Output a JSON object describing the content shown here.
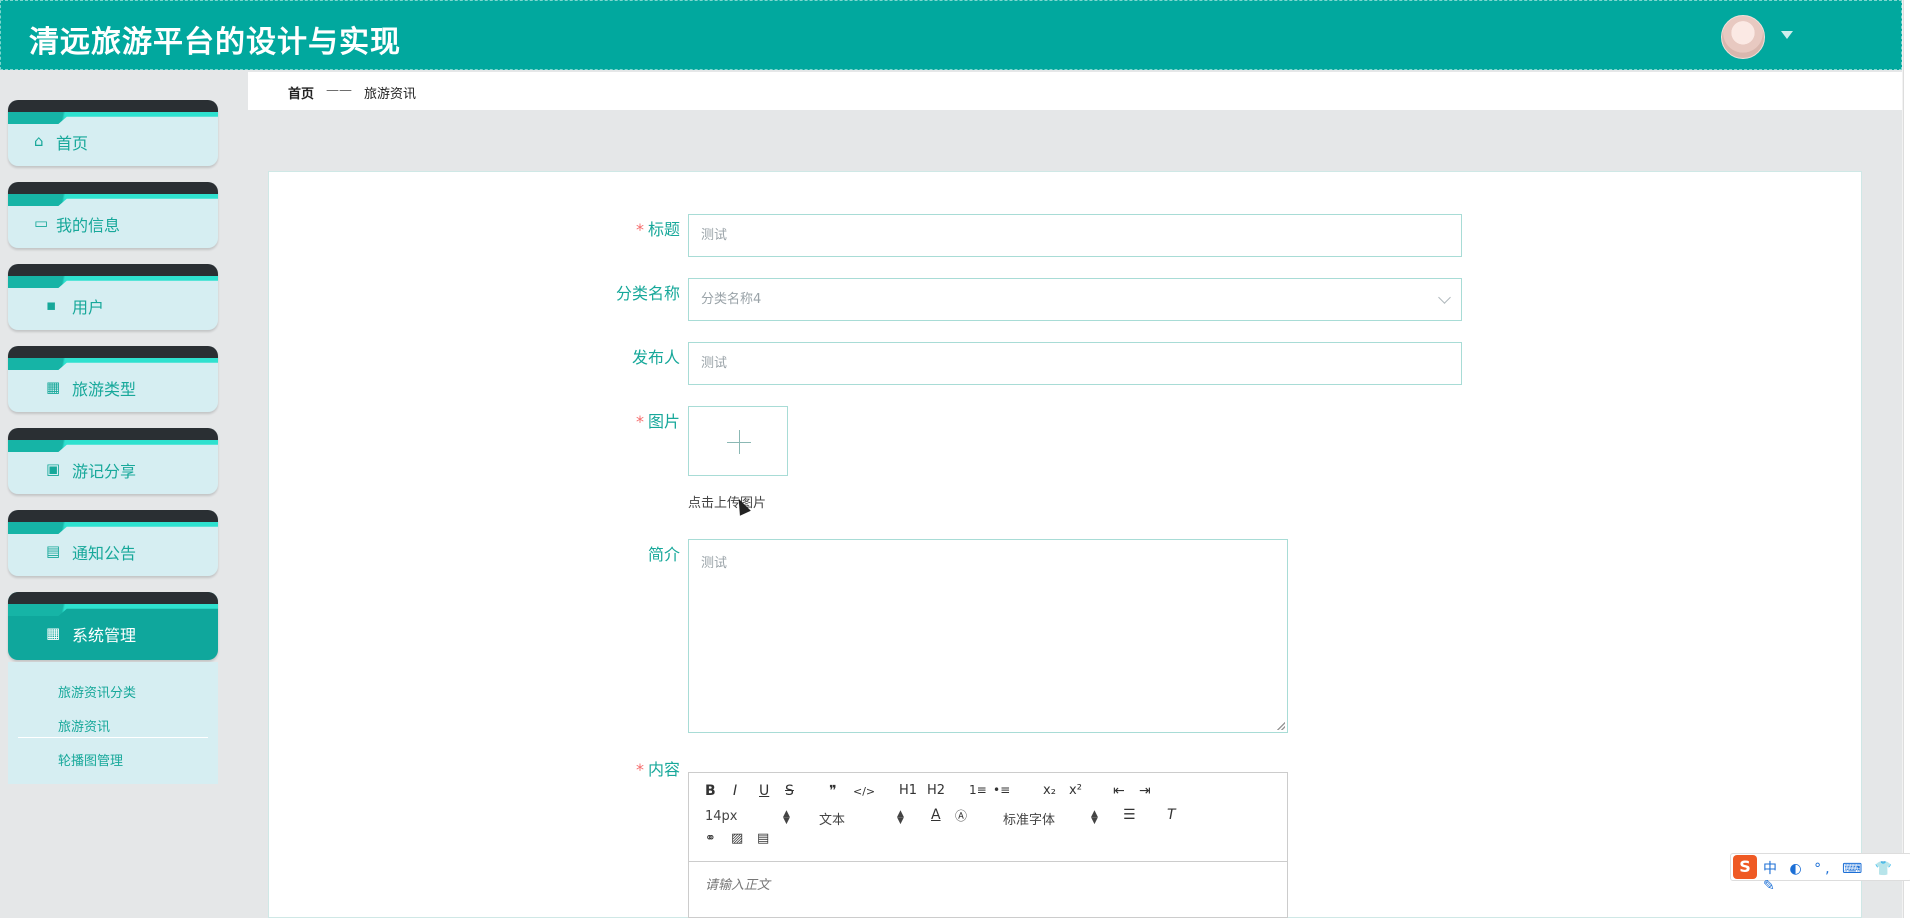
{
  "app": {
    "title": "清远旅游平台的设计与实现"
  },
  "sidebar": {
    "items": [
      {
        "label": "首页",
        "icon": "home-icon"
      },
      {
        "label": "我的信息",
        "icon": "wallet-icon"
      },
      {
        "label": "用户",
        "icon": "user-icon"
      },
      {
        "label": "旅游类型",
        "icon": "grid-icon"
      },
      {
        "label": "游记分享",
        "icon": "chart-icon"
      },
      {
        "label": "通知公告",
        "icon": "message-icon"
      },
      {
        "label": "系统管理",
        "icon": "grid-icon"
      }
    ],
    "submenu": [
      {
        "label": "旅游资讯分类"
      },
      {
        "label": "旅游资讯"
      },
      {
        "label": "轮播图管理"
      }
    ]
  },
  "breadcrumb": {
    "home": "首页",
    "separator": "——",
    "current": "旅游资讯"
  },
  "form": {
    "title": {
      "label": "标题",
      "required": "*",
      "value": "测试"
    },
    "category": {
      "label": "分类名称",
      "value": "分类名称4"
    },
    "publisher": {
      "label": "发布人",
      "value": "测试"
    },
    "image": {
      "label": "图片",
      "required": "*",
      "tip": "点击上传图片"
    },
    "intro": {
      "label": "简介",
      "value": "测试"
    },
    "content": {
      "label": "内容",
      "required": "*",
      "placeholder": "请输入正文"
    }
  },
  "editor": {
    "font_size": "14px",
    "text_type": "文本",
    "font_family": "标准字体",
    "buttons": [
      "B",
      "I",
      "U",
      "S",
      "❞",
      "</>",
      "H1",
      "H2",
      "1≡",
      "•≡",
      "x₂",
      "x²",
      "⇤",
      "⇥"
    ]
  },
  "colors": {
    "primary": "#01a89e",
    "accent": "#17a89a",
    "required": "#f56c6c"
  },
  "ime": {
    "logo": "S",
    "tray": "中 ◐ °, ⌨ 👕 ✎"
  }
}
